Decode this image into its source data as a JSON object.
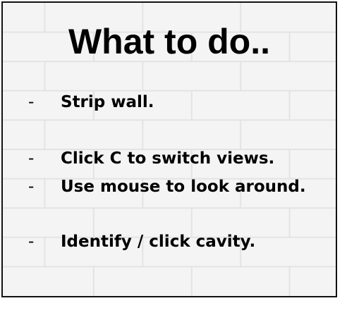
{
  "title": "What to do..",
  "instructions": [
    {
      "bullet": "-",
      "text": "Strip wall."
    },
    {
      "bullet": "-",
      "text": "Click C to switch views."
    },
    {
      "bullet": "-",
      "text": "Use mouse to look around."
    },
    {
      "bullet": "-",
      "text": "Identify / click cavity."
    }
  ],
  "colors": {
    "text": "#000000",
    "border": "#111111",
    "wall": "#f4f4f4",
    "mortar": "#e2e2e2"
  }
}
